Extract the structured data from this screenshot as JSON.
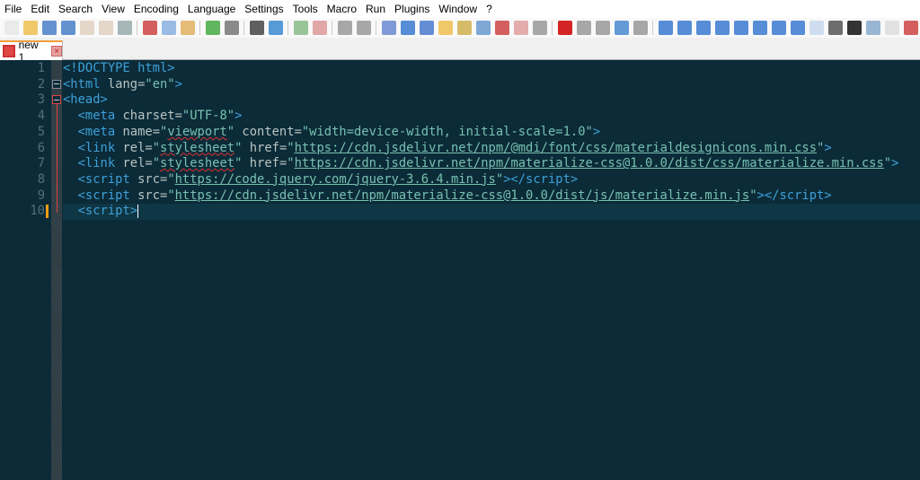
{
  "menu": [
    "File",
    "Edit",
    "Search",
    "View",
    "Encoding",
    "Language",
    "Settings",
    "Tools",
    "Macro",
    "Run",
    "Plugins",
    "Window",
    "?"
  ],
  "toolbar": [
    {
      "icon": "new-file-icon",
      "color": "#e8e8e8"
    },
    {
      "icon": "open-file-icon",
      "color": "#f0c050"
    },
    {
      "icon": "save-icon",
      "color": "#4a80c8"
    },
    {
      "icon": "save-all-icon",
      "color": "#4a80c8"
    },
    {
      "icon": "close-icon",
      "color": "#e0d0c0"
    },
    {
      "icon": "close-all-icon",
      "color": "#e0d0c0"
    },
    {
      "icon": "print-icon",
      "color": "#9aa"
    },
    "sep",
    {
      "icon": "cut-icon",
      "color": "#c44"
    },
    {
      "icon": "copy-icon",
      "color": "#8ab0e0"
    },
    {
      "icon": "paste-icon",
      "color": "#e0b060"
    },
    "sep",
    {
      "icon": "undo-icon",
      "color": "#4a4"
    },
    {
      "icon": "redo-icon",
      "color": "#777"
    },
    "sep",
    {
      "icon": "find-icon",
      "color": "#444"
    },
    {
      "icon": "replace-icon",
      "color": "#3a8ad0"
    },
    "sep",
    {
      "icon": "zoom-in-icon",
      "color": "#8b8"
    },
    {
      "icon": "zoom-out-icon",
      "color": "#d99"
    },
    "sep",
    {
      "icon": "sync-vertical-icon",
      "color": "#999"
    },
    {
      "icon": "sync-horizontal-icon",
      "color": "#999"
    },
    "sep",
    {
      "icon": "word-wrap-icon",
      "color": "#6a8ad0"
    },
    {
      "icon": "show-all-chars-icon",
      "color": "#3a7ad0"
    },
    {
      "icon": "indent-guide-icon",
      "color": "#4a7ad0"
    },
    {
      "icon": "udl-icon",
      "color": "#f0c050"
    },
    {
      "icon": "doc-map-icon",
      "color": "#d0b050"
    },
    {
      "icon": "doc-list-icon",
      "color": "#6a9ad0"
    },
    {
      "icon": "function-list-icon",
      "color": "#c44"
    },
    {
      "icon": "folder-workspace-icon",
      "color": "#e0a0a0"
    },
    {
      "icon": "monitoring-icon",
      "color": "#999"
    },
    "sep",
    {
      "icon": "record-macro-icon",
      "color": "#c00"
    },
    {
      "icon": "stop-macro-icon",
      "color": "#999"
    },
    {
      "icon": "play-macro-icon",
      "color": "#999"
    },
    {
      "icon": "play-multiple-icon",
      "color": "#4a8ad0"
    },
    {
      "icon": "save-macro-icon",
      "color": "#999"
    },
    "sep",
    {
      "icon": "plugin-1-icon",
      "color": "#3a7ad0"
    },
    {
      "icon": "plugin-2-icon",
      "color": "#3a7ad0"
    },
    {
      "icon": "plugin-3-icon",
      "color": "#3a7ad0"
    },
    {
      "icon": "plugin-4-icon",
      "color": "#3a7ad0"
    },
    {
      "icon": "triangle-up-icon",
      "color": "#3a7ad0"
    },
    {
      "icon": "triangle-down-icon",
      "color": "#3a7ad0"
    },
    {
      "icon": "plugin-5-icon",
      "color": "#3a7ad0"
    },
    {
      "icon": "plugin-6-icon",
      "color": "#3a7ad0"
    },
    {
      "icon": "spell-check-icon",
      "color": "#c8d8f0"
    },
    {
      "icon": "header-icon",
      "color": "#555"
    },
    {
      "icon": "json-icon",
      "color": "#111"
    },
    {
      "icon": "plugin-7-icon",
      "color": "#8ac"
    },
    {
      "icon": "check-icon",
      "color": "#ddd"
    },
    {
      "icon": "plugin-8-icon",
      "color": "#c44"
    }
  ],
  "tab": {
    "label": "new 1",
    "close": "×"
  },
  "editor": {
    "current_line": 10,
    "lines": [
      [
        [
          "t",
          "<!DOCTYPE html>"
        ]
      ],
      [
        [
          "t",
          "<html "
        ],
        [
          "a",
          "lang="
        ],
        [
          "v",
          "\"en\""
        ],
        [
          "t",
          ">"
        ]
      ],
      [
        [
          "t",
          "<head>"
        ]
      ],
      [
        [
          "s",
          "  "
        ],
        [
          "t",
          "<meta "
        ],
        [
          "a",
          "charset="
        ],
        [
          "v",
          "\"UTF-8\""
        ],
        [
          "t",
          ">"
        ]
      ],
      [
        [
          "s",
          "  "
        ],
        [
          "t",
          "<meta "
        ],
        [
          "a",
          "name="
        ],
        [
          "v",
          "\""
        ],
        [
          "vq",
          "viewport"
        ],
        [
          "v",
          "\""
        ],
        [
          "a",
          " content="
        ],
        [
          "v",
          "\"width=device-width, initial-scale=1.0\""
        ],
        [
          "t",
          ">"
        ]
      ],
      [
        [
          "s",
          "  "
        ],
        [
          "t",
          "<link "
        ],
        [
          "a",
          "rel="
        ],
        [
          "v",
          "\""
        ],
        [
          "vq",
          "stylesheet"
        ],
        [
          "v",
          "\""
        ],
        [
          "a",
          " href="
        ],
        [
          "v",
          "\""
        ],
        [
          "vu",
          "https://cdn.jsdelivr.net/npm/@mdi/font/css/materialdesignicons.min.css"
        ],
        [
          "v",
          "\""
        ],
        [
          "t",
          ">"
        ]
      ],
      [
        [
          "s",
          "  "
        ],
        [
          "t",
          "<link "
        ],
        [
          "a",
          "rel="
        ],
        [
          "v",
          "\""
        ],
        [
          "vq",
          "stylesheet"
        ],
        [
          "v",
          "\""
        ],
        [
          "a",
          " href="
        ],
        [
          "v",
          "\""
        ],
        [
          "vu",
          "https://cdn.jsdelivr.net/npm/materialize-css@1.0.0/dist/css/materialize.min.css"
        ],
        [
          "v",
          "\""
        ],
        [
          "t",
          ">"
        ]
      ],
      [
        [
          "s",
          "  "
        ],
        [
          "t",
          "<script "
        ],
        [
          "a",
          "src="
        ],
        [
          "v",
          "\""
        ],
        [
          "vu",
          "https://code.jquery.com/jquery-3.6.4.min.js"
        ],
        [
          "v",
          "\""
        ],
        [
          "t",
          "></script>"
        ]
      ],
      [
        [
          "s",
          "  "
        ],
        [
          "t",
          "<script "
        ],
        [
          "a",
          "src="
        ],
        [
          "v",
          "\""
        ],
        [
          "vu",
          "https://cdn.jsdelivr.net/npm/materialize-css@1.0.0/dist/js/materialize.min.js"
        ],
        [
          "v",
          "\""
        ],
        [
          "t",
          "></script>"
        ]
      ],
      [
        [
          "s",
          "  "
        ],
        [
          "t",
          "<script>"
        ]
      ]
    ]
  }
}
